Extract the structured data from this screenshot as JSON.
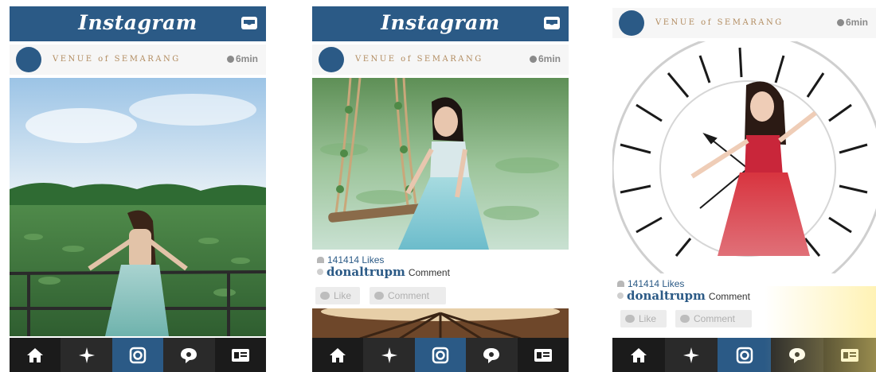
{
  "colors": {
    "brand": "#2b5a86",
    "tabbar": "#1f1f1f",
    "venue_text": "#b28c60"
  },
  "app": {
    "logo": "Instagram"
  },
  "posts": [
    {
      "venue": "VENUE of SEMARANG",
      "time": "6min"
    },
    {
      "venue": "VENUE of SEMARANG",
      "time": "6min",
      "likes": "141414 Likes",
      "username": "donaltrupm",
      "comment_label": "Comment",
      "like_button": "Like",
      "comment_button": "Comment"
    },
    {
      "venue": "VENUE of SEMARANG",
      "time": "6min",
      "likes": "141414 Likes",
      "username": "donaltrupm",
      "comment_label": "Comment",
      "like_button": "Like",
      "comment_button": "Comment"
    }
  ],
  "icons": [
    "home-icon",
    "explore-icon",
    "camera-icon",
    "activity-icon",
    "profile-icon",
    "inbox-icon",
    "clock-icon",
    "heart-icon",
    "comment-icon"
  ]
}
